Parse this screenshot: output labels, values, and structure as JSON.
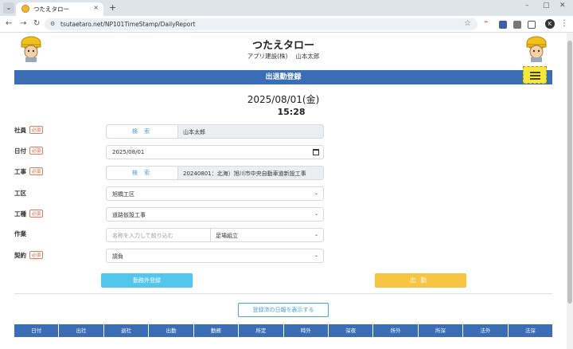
{
  "browser": {
    "tab_title": "つたえタロー",
    "url": "tsutaetaro.net/NP101TimeStamp/DailyReport",
    "profile_initial": "K"
  },
  "app": {
    "title": "つたえタロー",
    "subtitle": "アプリ建設(株)　 山本太郎",
    "banner": "出退勤登録"
  },
  "datetime": {
    "date": "2025/08/01(金)",
    "time": "15:28"
  },
  "required_label": "必須",
  "form": {
    "employee": {
      "label": "社員",
      "search": "検 索",
      "value": "山本太郎"
    },
    "date": {
      "label": "日付",
      "value": "2025/08/01"
    },
    "project": {
      "label": "工事",
      "search": "検 索",
      "value": "20240801：北海）旭川市中央自動車道新設工事"
    },
    "zone": {
      "label": "工区",
      "value": "旭橋工区"
    },
    "work_type": {
      "label": "工種",
      "value": "道路仮設工事"
    },
    "task": {
      "label": "作業",
      "placeholder": "名称を入力して絞り込む",
      "value": "足場組立"
    },
    "contract": {
      "label": "契約",
      "value": "請負"
    }
  },
  "buttons": {
    "register_outside": "勤務外登録",
    "clock_in": "出勤",
    "show_daily": "登録済の日報を表示する"
  },
  "table": {
    "headers": [
      "日付",
      "出社",
      "退社",
      "出勤",
      "勤務",
      "所定",
      "時外",
      "深夜",
      "所外",
      "所深",
      "法外",
      "法深"
    ]
  }
}
